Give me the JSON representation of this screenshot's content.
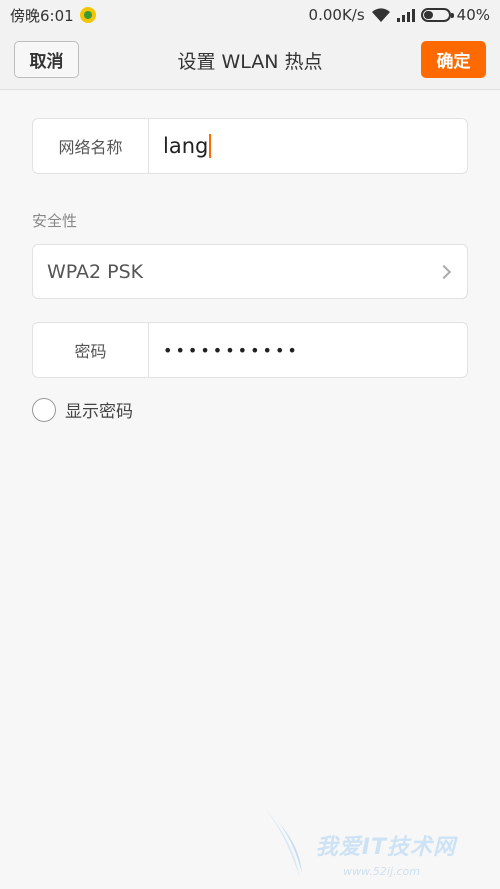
{
  "status_bar": {
    "time": "傍晚6:01",
    "speed": "0.00K/s",
    "battery": "40%",
    "battery_level": 0.4
  },
  "action_bar": {
    "cancel_label": "取消",
    "title": "设置 WLAN 热点",
    "confirm_label": "确定",
    "accent_color": "#ff6a00"
  },
  "form": {
    "network_name_label": "网络名称",
    "network_name_value": "lang",
    "security_label": "安全性",
    "security_value": "WPA2 PSK",
    "password_label": "密码",
    "password_value": "•••••••••••",
    "show_password_label": "显示密码"
  },
  "watermark": {
    "text": "我爱IT技术网",
    "url": "www.52ij.com"
  },
  "icons": [
    "app-icon",
    "wifi-icon",
    "signal-icon",
    "battery-icon",
    "chevron-right-icon",
    "radio-icon"
  ]
}
